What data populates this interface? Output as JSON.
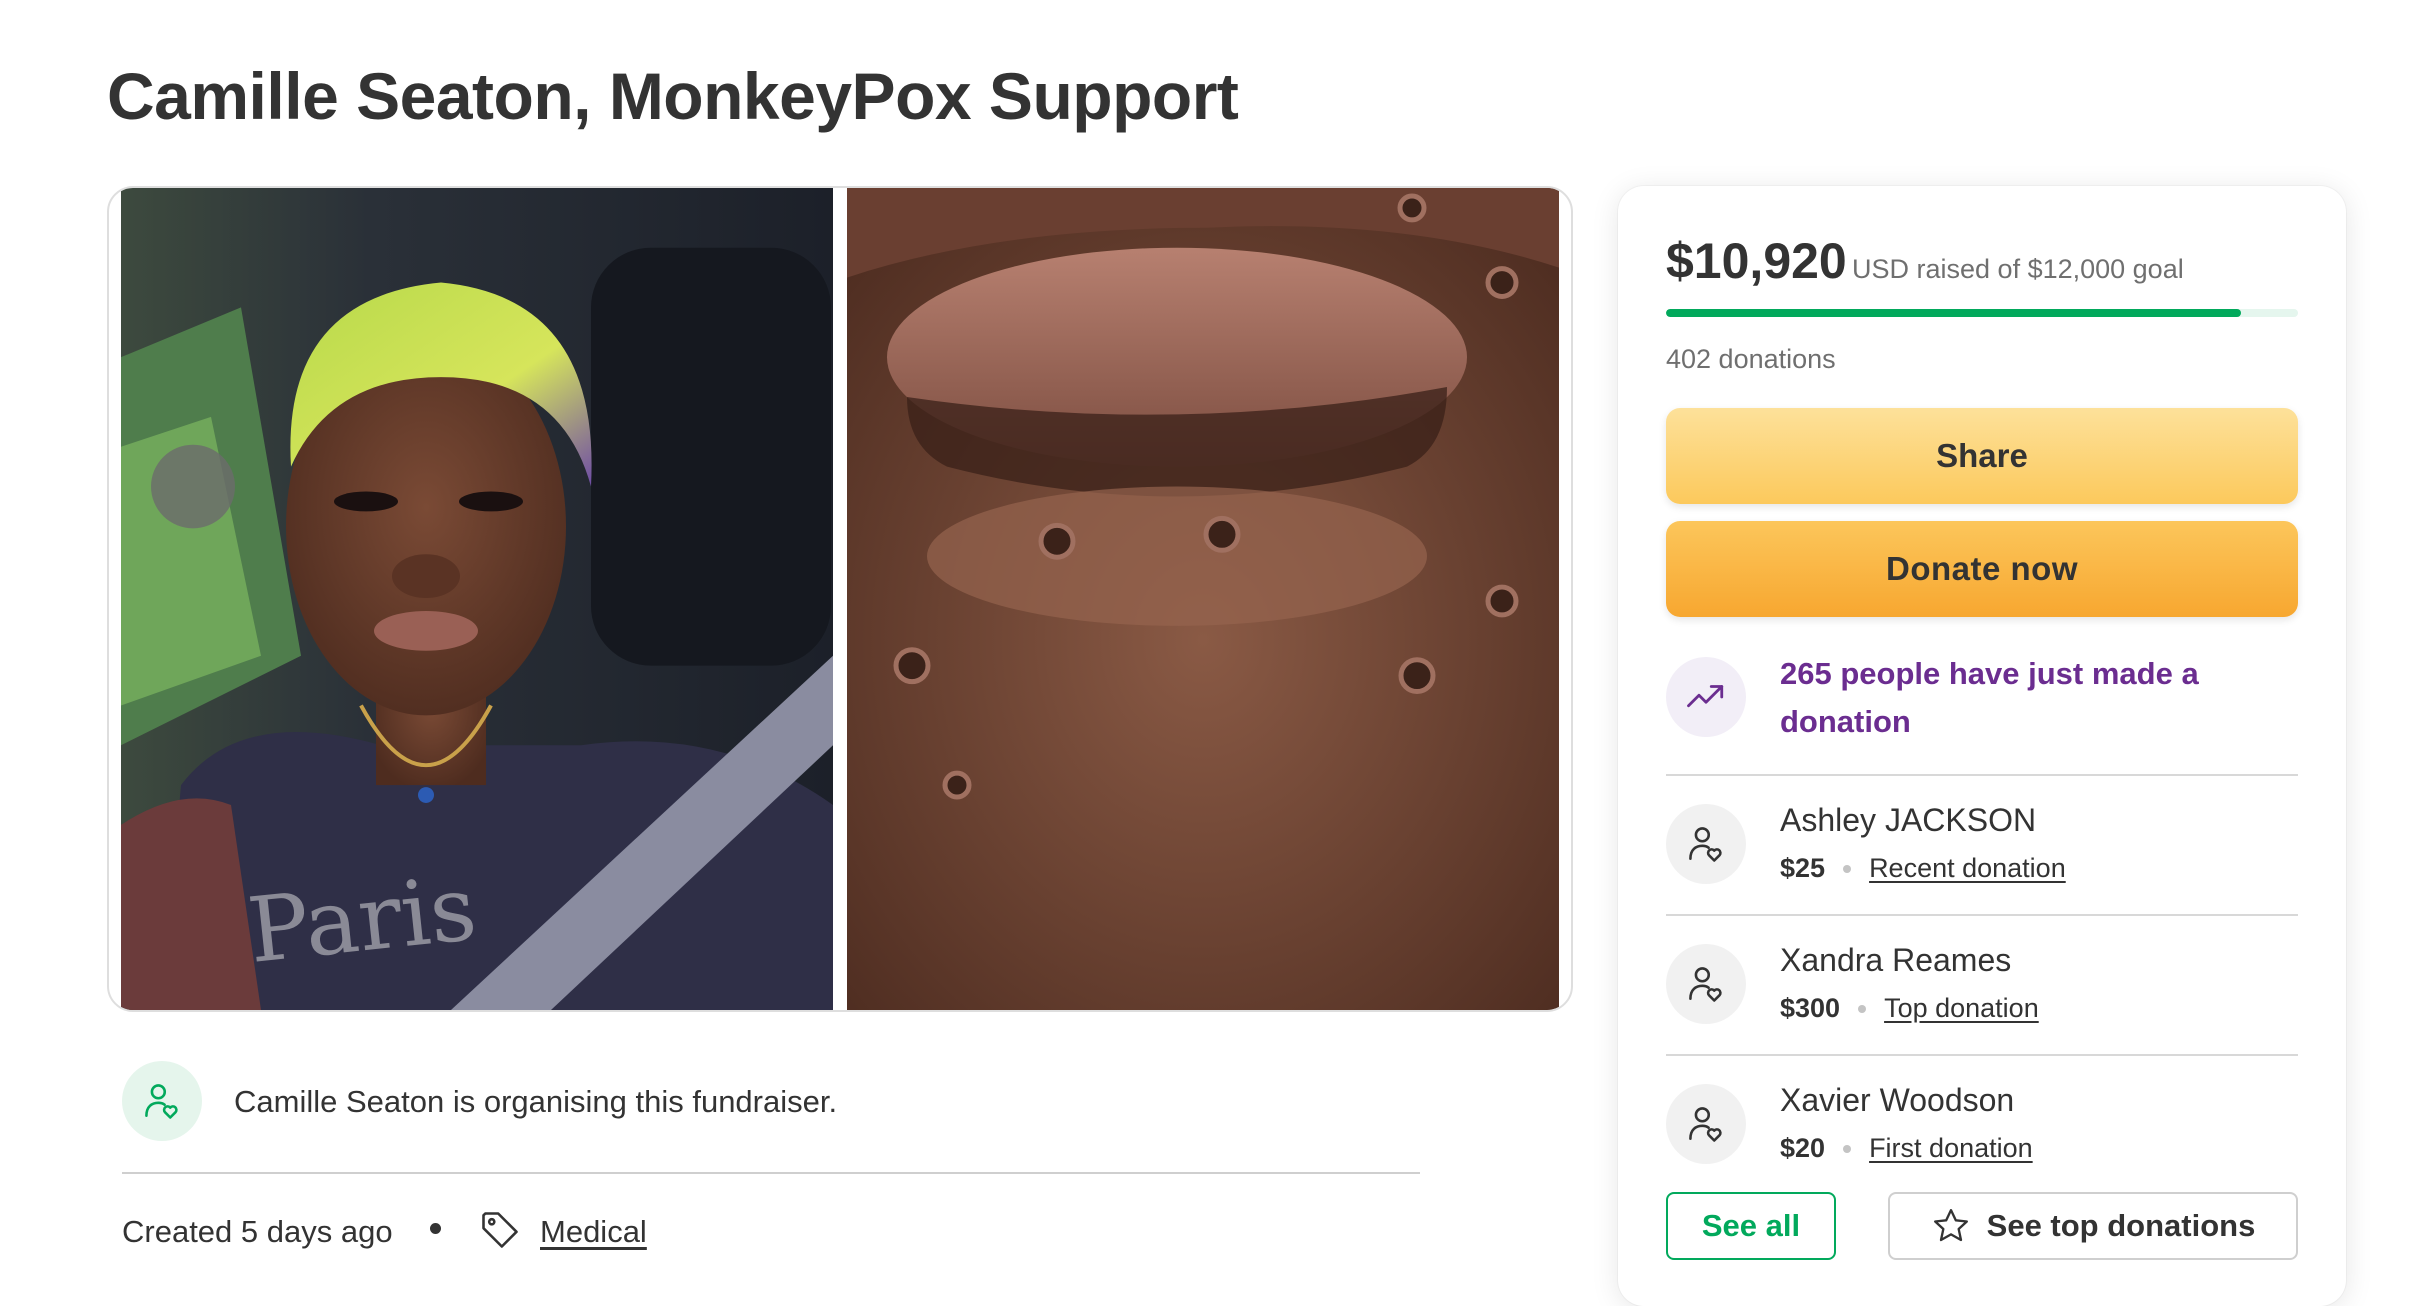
{
  "page": {
    "title": "Camille Seaton, MonkeyPox Support"
  },
  "media": {
    "left_photo": "portrait-selfie-photo",
    "right_photo": "closeup-lip-lesions-photo"
  },
  "organiser": {
    "icon": "person-heart-icon",
    "text": "Camille Seaton is organising this fundraiser.",
    "created": "Created 5 days ago",
    "category_icon": "tag-icon",
    "category": "Medical"
  },
  "donation_card": {
    "raised": "$10,920",
    "raised_suffix": "USD raised of $12,000 goal",
    "progress_fraction": 0.91,
    "donations_count": "402 donations",
    "share_label": "Share",
    "donate_label": "Donate now",
    "trend_icon": "trending-up-icon",
    "trend_text": "265 people have just made a donation",
    "donors": [
      {
        "name": "Ashley JACKSON",
        "amount": "$25",
        "tag": "Recent donation"
      },
      {
        "name": "Xandra Reames",
        "amount": "$300",
        "tag": "Top donation"
      },
      {
        "name": "Xavier Woodson",
        "amount": "$20",
        "tag": "First donation"
      }
    ],
    "see_all_label": "See all",
    "see_top_label": "See top donations",
    "see_top_icon": "star-outline-icon"
  },
  "colors": {
    "brand_green": "#02a95c",
    "trend_purple": "#6b2d90",
    "share_yellow": "#fcd77f",
    "donate_orange": "#f9b43f",
    "text": "#333333"
  }
}
